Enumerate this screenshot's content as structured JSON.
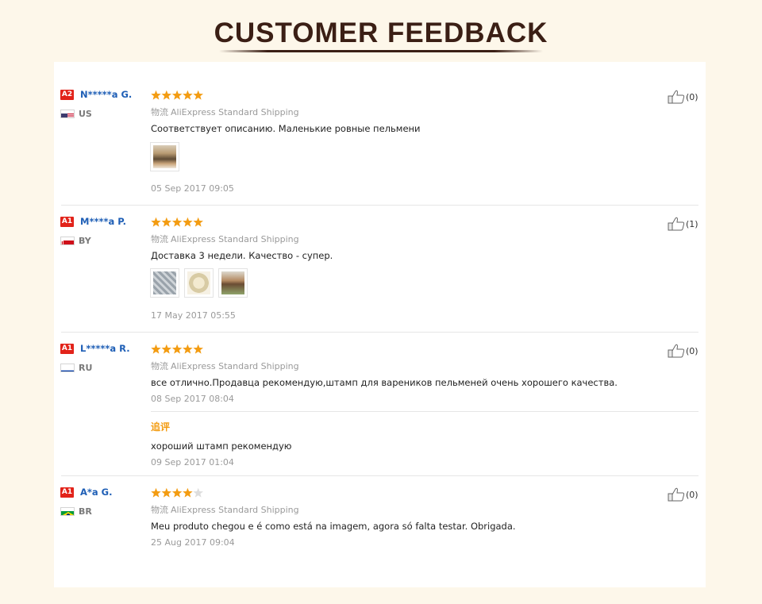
{
  "page": {
    "title": "CUSTOMER FEEDBACK"
  },
  "colors": {
    "star_filled": "#f39c12",
    "star_empty": "#dddddd",
    "badge": "#e2231a",
    "name": "#1f5fb6",
    "title": "#3b1f15"
  },
  "reviews": [
    {
      "level": "A2",
      "name": "N*****a G.",
      "country": "US",
      "flag_icon": "us-flag-icon",
      "rating": 5,
      "shipping_tag": "物流",
      "shipping": "AliExpress Standard Shipping",
      "comment": "Соответствует описанию. Маленькие ровные пельмени",
      "photos": 1,
      "date": "05 Sep 2017 09:05",
      "helpful": "(0)"
    },
    {
      "level": "A1",
      "name": "M****a P.",
      "country": "BY",
      "flag_icon": "by-flag-icon",
      "rating": 5,
      "shipping_tag": "物流",
      "shipping": "AliExpress Standard Shipping",
      "comment": "Доставка 3 недели. Качество - супер.",
      "photos": 3,
      "date": "17 May 2017 05:55",
      "helpful": "(1)"
    },
    {
      "level": "A1",
      "name": "L*****a R.",
      "country": "RU",
      "flag_icon": "ru-flag-icon",
      "rating": 5,
      "shipping_tag": "物流",
      "shipping": "AliExpress Standard Shipping",
      "comment": "все отлично.Продавца рекомендую,штамп для вареников пельменей очень хорошего качества.",
      "date": "08 Sep 2017 08:04",
      "helpful": "(0)",
      "followup": {
        "label": "追评",
        "comment": "хороший штамп рекомендую",
        "date": "09 Sep 2017 01:04"
      }
    },
    {
      "level": "A1",
      "name": "A*a G.",
      "country": "BR",
      "flag_icon": "br-flag-icon",
      "rating": 4,
      "shipping_tag": "物流",
      "shipping": "AliExpress Standard Shipping",
      "comment": "Meu produto chegou e é como está na imagem, agora só falta testar. Obrigada.",
      "date": "25 Aug 2017 09:04",
      "helpful": "(0)"
    }
  ]
}
